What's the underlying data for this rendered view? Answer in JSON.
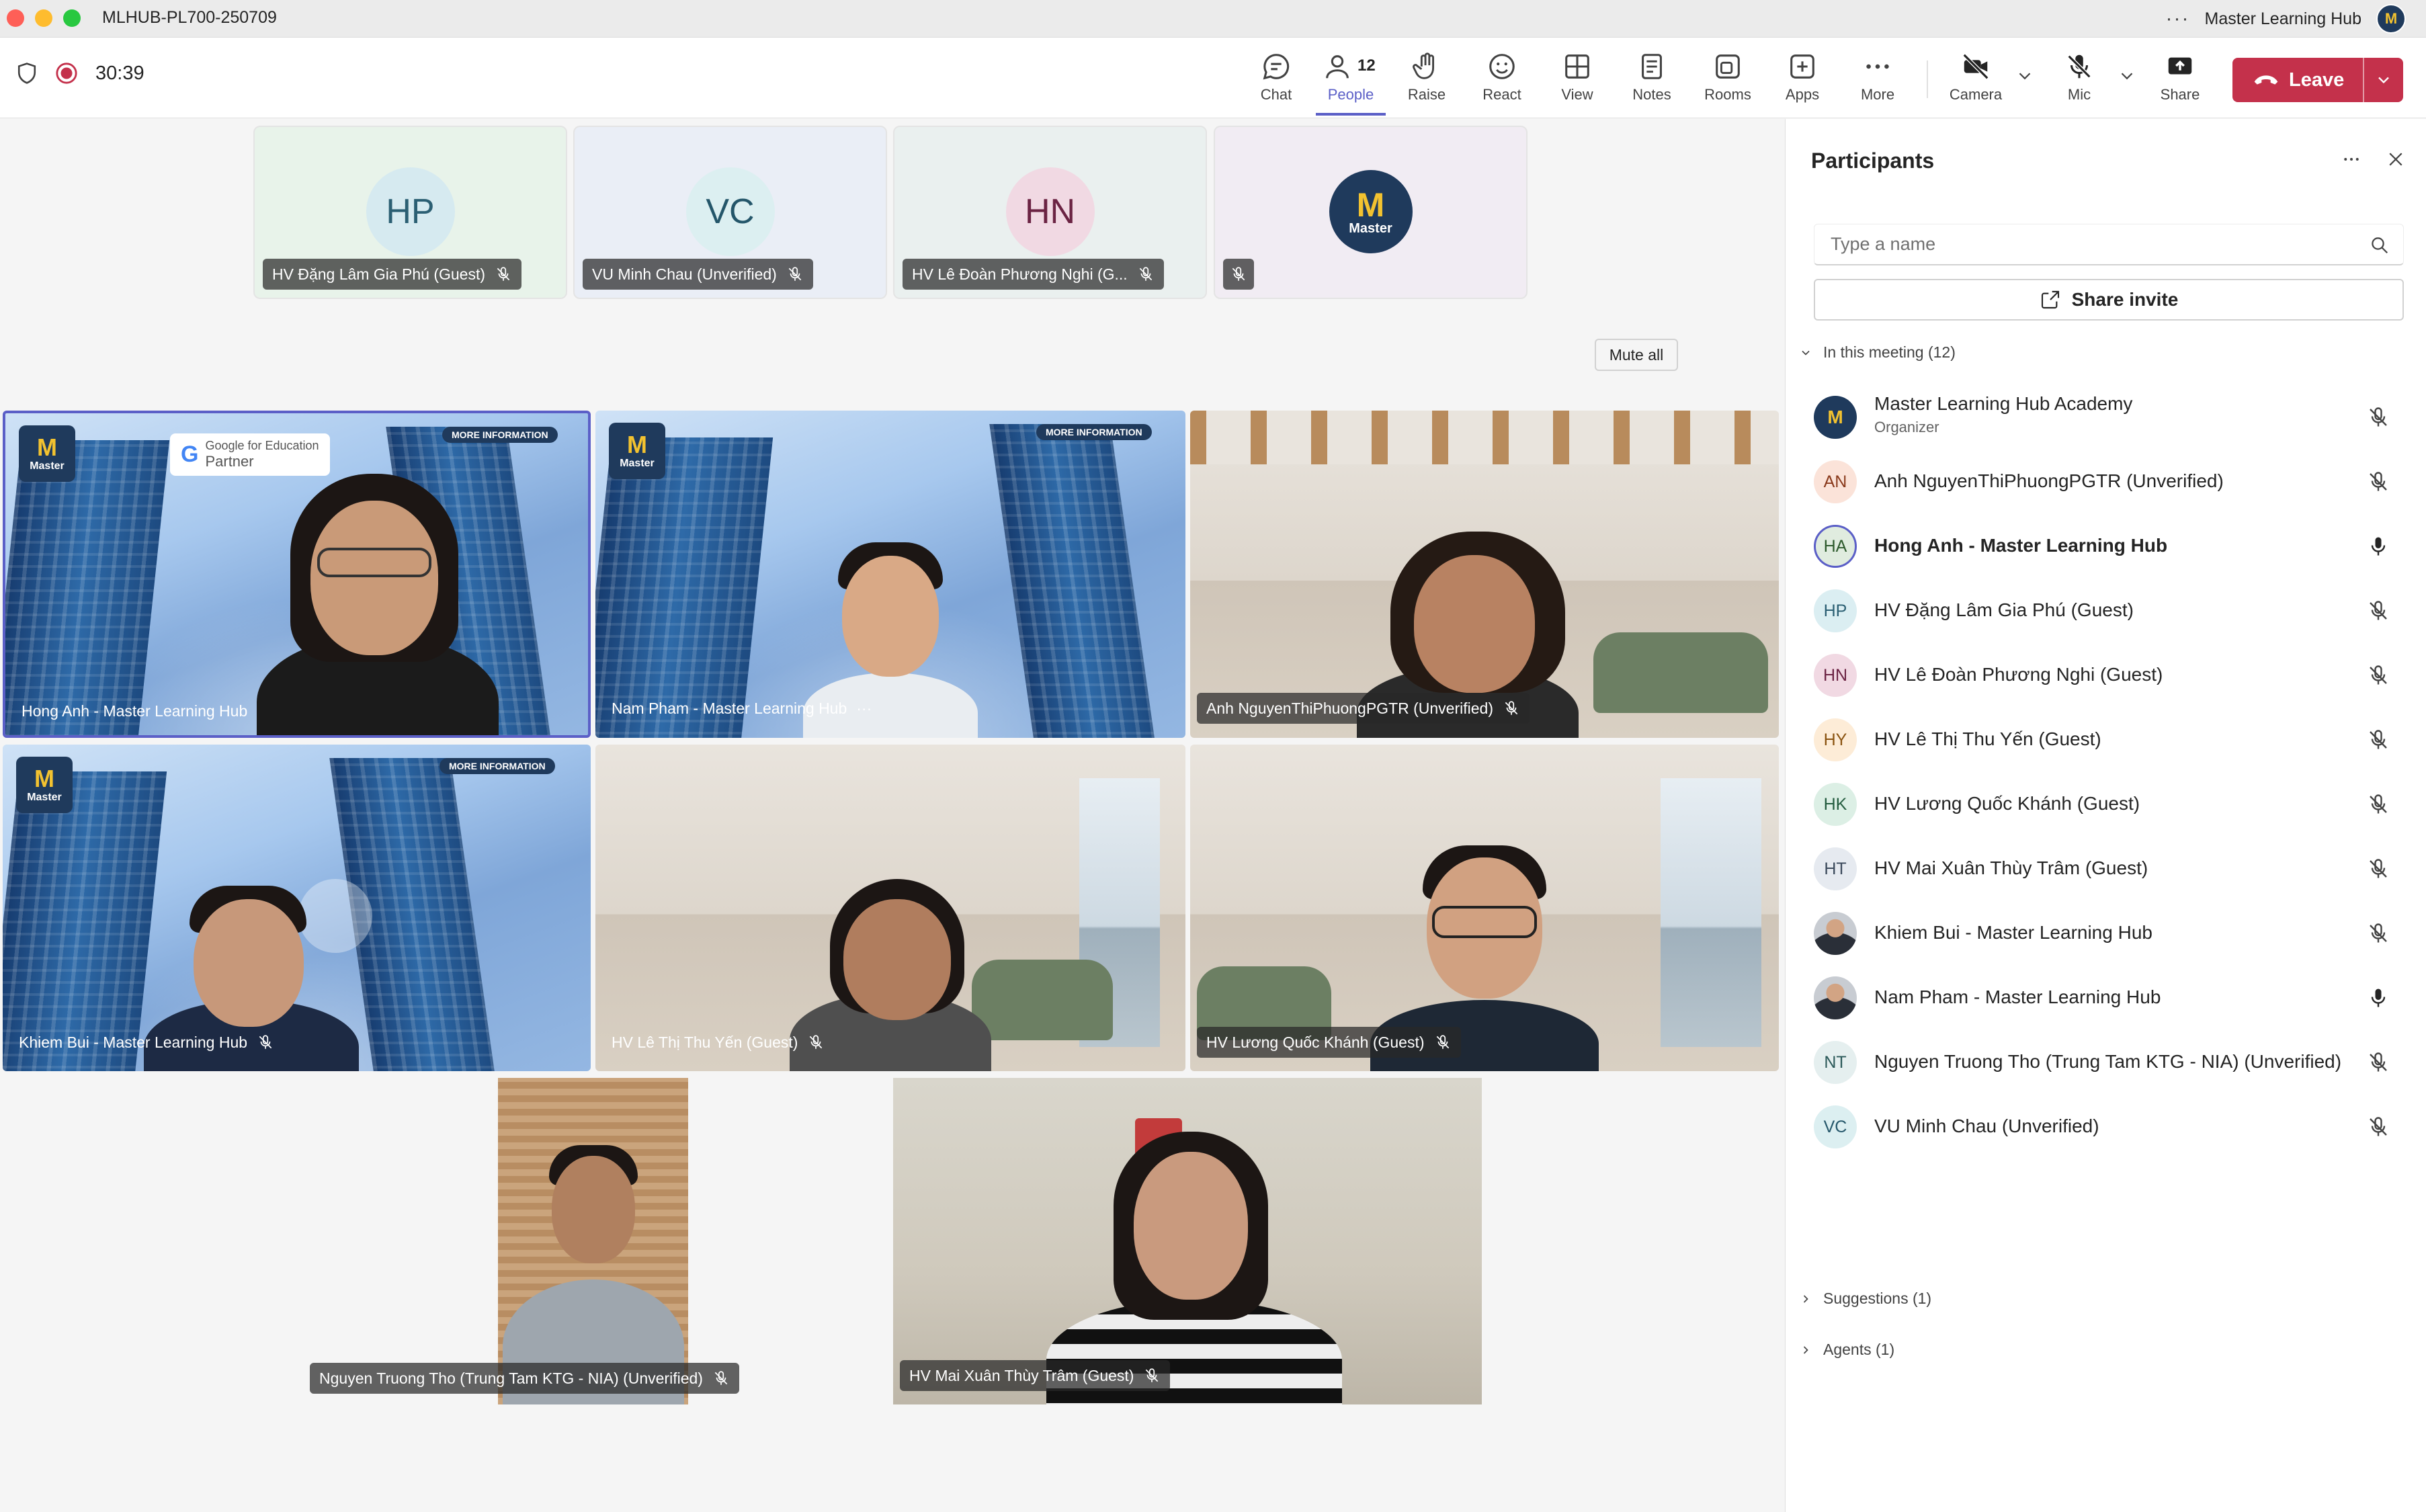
{
  "window": {
    "title": "MLHUB-PL700-250709",
    "account": "Master Learning Hub",
    "account_initial": "M"
  },
  "meeting": {
    "timer": "30:39"
  },
  "toolbar": {
    "chat": "Chat",
    "people": "People",
    "people_count": "12",
    "raise": "Raise",
    "react": "React",
    "view": "View",
    "notes": "Notes",
    "rooms": "Rooms",
    "apps": "Apps",
    "more": "More",
    "camera": "Camera",
    "mic": "Mic",
    "share": "Share",
    "leave": "Leave"
  },
  "top_tiles": [
    {
      "initials": "HP",
      "name": "HV Đặng Lâm Gia Phú (Guest)",
      "bg": "#e8f3ea",
      "avbg": "#d6eaf0",
      "avfg": "#2b5f73"
    },
    {
      "initials": "VC",
      "name": "VU Minh Chau (Unverified)",
      "bg": "#eaeef6",
      "avbg": "#dceff1",
      "avfg": "#24566a"
    },
    {
      "initials": "HN",
      "name": "HV Lê Đoàn Phương Nghi (G...",
      "bg": "#eaf0ef",
      "avbg": "#f1d9e3",
      "avfg": "#6b2343"
    },
    {
      "initials": "",
      "name": "",
      "bg": "#f1ecf3",
      "avbg": "#1f3a5c",
      "avfg": "#f2c230"
    }
  ],
  "logo": {
    "mark": "M",
    "word": "Master"
  },
  "branding": {
    "partner_line1": "Google for Education",
    "partner_line2": "Partner",
    "more_info": "MORE INFORMATION"
  },
  "video_tiles": [
    {
      "name": "Hong Anh - Master Learning Hub"
    },
    {
      "name": "Nam Pham - Master Learning Hub",
      "more": "···"
    },
    {
      "name": "Anh NguyenThiPhuongPGTR (Unverified)"
    },
    {
      "name": "Khiem Bui - Master Learning Hub"
    },
    {
      "name": "HV Lê Thị Thu Yến (Guest)"
    },
    {
      "name": "HV Lương Quốc Khánh (Guest)"
    },
    {
      "name": "Nguyen Truong Tho (Trung Tam KTG - NIA) (Unverified)"
    },
    {
      "name": "HV Mai Xuân Thùy Trâm (Guest)"
    }
  ],
  "panel": {
    "title": "Participants",
    "search_placeholder": "Type a name",
    "share_invite": "Share invite",
    "in_meeting": "In this meeting (12)",
    "mute_all": "Mute all",
    "suggestions": "Suggestions (1)",
    "agents": "Agents (1)",
    "participants": [
      {
        "initials": "M",
        "name": "Master Learning Hub Academy",
        "sub": "Organizer",
        "avbg": "#1f3a5c",
        "avfg": "#f2c230",
        "muted": true
      },
      {
        "initials": "AN",
        "name": "Anh NguyenThiPhuongPGTR (Unverified)",
        "avbg": "#fbe3d9",
        "avfg": "#8a3a1c",
        "muted": true
      },
      {
        "initials": "HA",
        "name": "Hong Anh - Master Learning Hub",
        "avbg": "#e0ecdf",
        "avfg": "#2d5a2c",
        "muted": false,
        "bold": true
      },
      {
        "initials": "HP",
        "name": "HV Đặng Lâm Gia Phú (Guest)",
        "avbg": "#dbeef2",
        "avfg": "#2b5f73",
        "muted": true
      },
      {
        "initials": "HN",
        "name": "HV Lê Đoàn Phương Nghi (Guest)",
        "avbg": "#f1d9e3",
        "avfg": "#6b2343",
        "muted": true
      },
      {
        "initials": "HY",
        "name": "HV Lê Thị Thu Yến (Guest)",
        "avbg": "#fdecd7",
        "avfg": "#8a5310",
        "muted": true
      },
      {
        "initials": "HK",
        "name": "HV Lương Quốc Khánh (Guest)",
        "avbg": "#dcefe5",
        "avfg": "#245c3f",
        "muted": true
      },
      {
        "initials": "HT",
        "name": "HV Mai Xuân Thùy Trâm (Guest)",
        "avbg": "#e6eaf0",
        "avfg": "#3c4a5c",
        "muted": true
      },
      {
        "initials": "",
        "name": "Khiem Bui - Master Learning Hub",
        "avbg": "#5f6b78",
        "avfg": "#ffffff",
        "muted": true,
        "photo": true
      },
      {
        "initials": "",
        "name": "Nam Pham - Master Learning Hub",
        "avbg": "#8a7a70",
        "avfg": "#ffffff",
        "muted": false,
        "photo": true
      },
      {
        "initials": "NT",
        "name": "Nguyen Truong Tho (Trung Tam KTG - NIA) (Unverified)",
        "avbg": "#e5efef",
        "avfg": "#2b5959",
        "muted": true
      },
      {
        "initials": "VC",
        "name": "VU Minh Chau (Unverified)",
        "avbg": "#dceff1",
        "avfg": "#24566a",
        "muted": true
      }
    ]
  },
  "colors": {
    "accent": "#5b5fc7",
    "leave": "#c4314b",
    "record": "#c4314b"
  }
}
